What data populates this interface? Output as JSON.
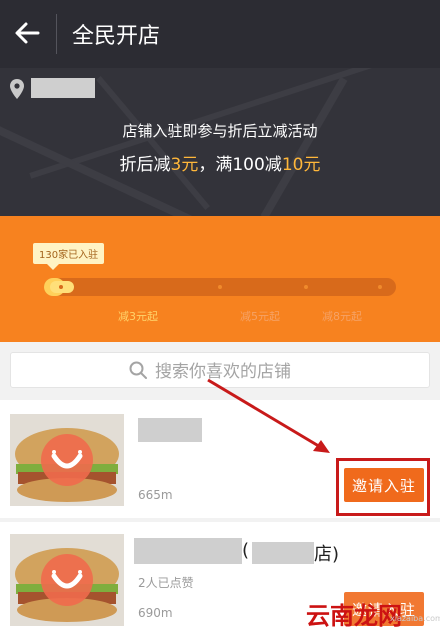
{
  "header": {
    "title": "全民开店",
    "back_icon": "back-arrow-icon"
  },
  "hero": {
    "line1": "店铺入驻即参与折后立减活动",
    "line2_prefix": "折后减",
    "line2_amount1": "3元",
    "line2_middle": "，满100减",
    "line2_amount2": "10元"
  },
  "progress": {
    "badge": "130家已入驻",
    "level": 0.06,
    "steps": [
      "减3元起",
      "减5元起",
      "减8元起"
    ]
  },
  "search": {
    "placeholder": "搜索你喜欢的店铺"
  },
  "stores": [
    {
      "distance": "665m",
      "invite_label": "邀请入驻"
    },
    {
      "shop_suffix": "店)",
      "open_paren": "(",
      "likes": "2人已点赞",
      "distance": "690m",
      "invite_label": "邀请入驻"
    }
  ],
  "watermark": {
    "text": "云南龙网",
    "url": "xiazaiba.com"
  },
  "colors": {
    "accent": "#f7821f",
    "highlight": "#ffb73a",
    "button": "#f06a1c",
    "annotation": "#c81a1a"
  }
}
